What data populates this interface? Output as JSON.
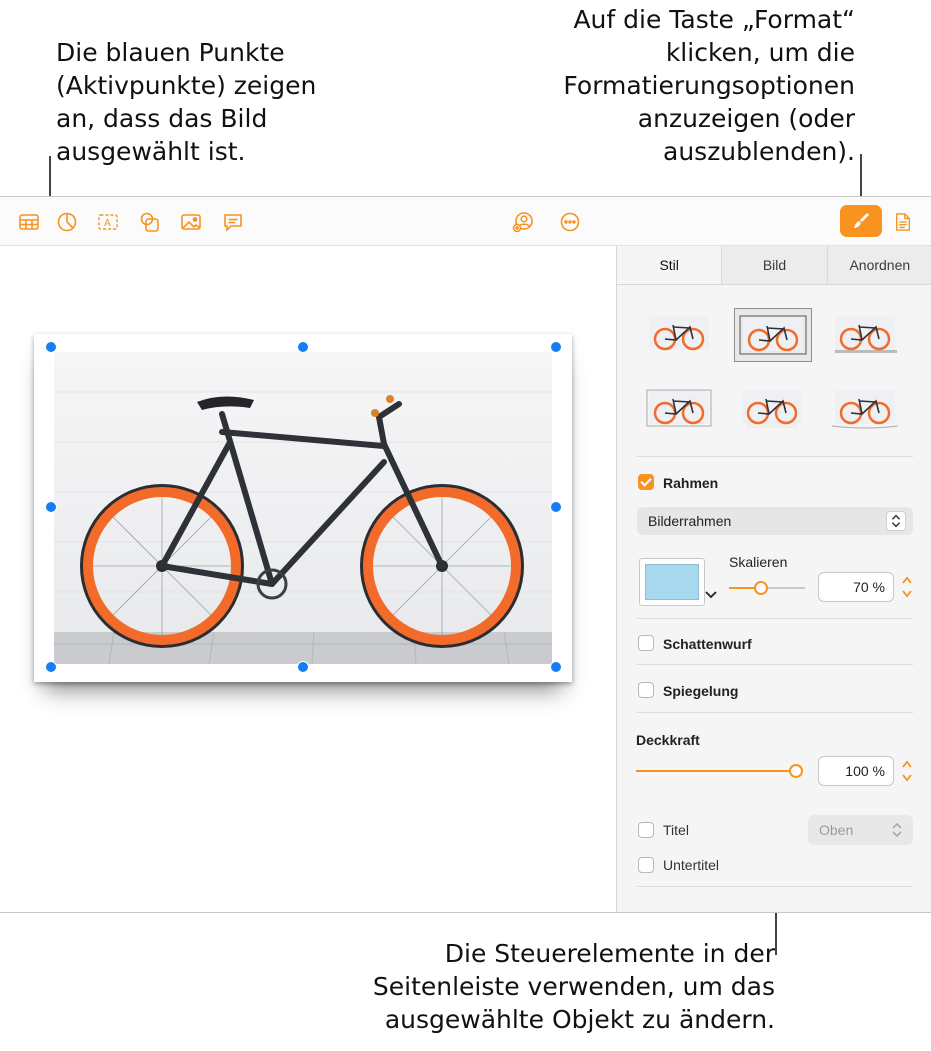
{
  "callouts": {
    "left": "Die blauen Punkte\n(Aktivpunkte) zeigen\nan, dass das Bild\nausgewählt ist.",
    "right": "Auf die Taste „Format“\nklicken, um die\nFormatierungsoptionen\nanzuzeigen (oder\nauszublenden).",
    "bottom": "Die Steuerelemente in der\nSeitenleiste verwenden, um das\nausgewählte Objekt zu ändern."
  },
  "toolbar": {
    "left_icons": [
      "table-icon",
      "chart-icon",
      "text-icon",
      "shape-icon",
      "media-icon",
      "comment-icon"
    ],
    "center_icons": [
      "collaborate-icon",
      "more-icon"
    ],
    "right_icons": [
      "format-paintbrush-icon",
      "document-icon"
    ]
  },
  "sidebar": {
    "tabs": [
      "Stil",
      "Bild",
      "Anordnen"
    ],
    "active_tab": "Stil",
    "style_presets_selected_index": 1,
    "border": {
      "label": "Rahmen",
      "checked": true,
      "type": "Bilderrahmen"
    },
    "scale": {
      "label": "Skalieren",
      "value": "70 %",
      "level": 0.7
    },
    "shadow": {
      "label": "Schattenwurf",
      "checked": false
    },
    "reflection": {
      "label": "Spiegelung",
      "checked": false
    },
    "opacity": {
      "label": "Deckkraft",
      "value": "100 %",
      "level": 1.0
    },
    "caption": {
      "title_label": "Titel",
      "title_checked": false,
      "position": "Oben",
      "subtitle_label": "Untertitel",
      "subtitle_checked": false
    }
  },
  "colors": {
    "accent": "#f7931e",
    "handle": "#1a7cf5",
    "frame_swatch": "#a8d8ee"
  }
}
